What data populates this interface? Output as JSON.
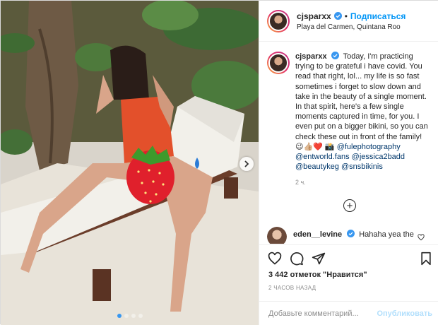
{
  "header": {
    "username": "cjsparxx",
    "separator": "•",
    "follow_label": "Подписаться",
    "location": "Playa del Carmen, Quintana Roo",
    "avatar_icon": "avatar"
  },
  "caption": {
    "username": "cjsparxx",
    "text": "Today, I'm practicing trying to be grateful i have covid. You read that right, lol... my life is so fast sometimes i forget to slow down and take in the beauty of a single moment. In that spirit, here's a few single moments captured in time, for you. I even put on a bigger bikini, so you can check these out in front of the family!",
    "emojis": "😉👍🏼❤️ 📸",
    "mentions": [
      "@fulephotography",
      "@entworld.fans",
      "@jessica2badd",
      "@beautykeg",
      "@snsbikinis"
    ],
    "mention_separator": " ",
    "time": "2 ч."
  },
  "load_more_icon": "plus-circle-icon",
  "comment": {
    "username": "eden__levine",
    "text": "Hahaha yea the"
  },
  "actions": {
    "like_icon": "heart-icon",
    "comment_icon": "comment-icon",
    "share_icon": "share-icon",
    "save_icon": "bookmark-icon",
    "likes": "3 442 отметок \"Нравится\"",
    "time": "2 ЧАСОВ НАЗАД"
  },
  "add_comment": {
    "placeholder": "Добавьте комментарий...",
    "publish_label": "Опубликовать"
  },
  "carousel": {
    "slides": 4,
    "active_slide": 1
  },
  "colors": {
    "link_blue": "#0095f6",
    "verified_blue": "#3897f0",
    "publish_disabled": "#b2dffc",
    "mention": "#00376b"
  }
}
